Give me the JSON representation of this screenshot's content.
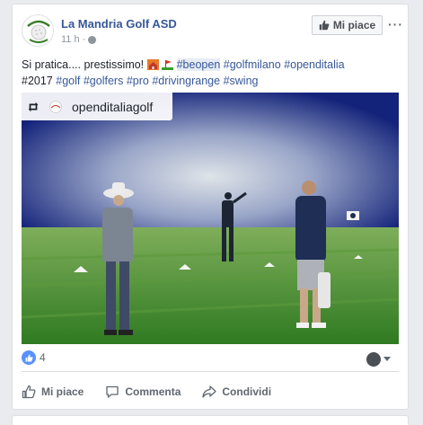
{
  "post": {
    "author": "La Mandria Golf ASD",
    "time": "11 h",
    "separator": "·",
    "text_intro": "Si pratica.... prestissimo!",
    "hashtags_line1": [
      {
        "text": "#beopen",
        "highlight": true
      },
      {
        "text": "#golfmilano",
        "highlight": false
      },
      {
        "text": "#openditalia",
        "highlight": false
      }
    ],
    "hashtags_line2": [
      "#2017",
      "#golf",
      "#golfers",
      "#pro",
      "#drivingrange",
      "#swing"
    ],
    "instagram_user": "openditaliagolf",
    "like_count": "4"
  },
  "header": {
    "like_page_label": "Mi piace",
    "more_label": "···"
  },
  "actions": {
    "like": "Mi piace",
    "comment": "Commenta",
    "share": "Condividi"
  },
  "colors": {
    "link": "#365899",
    "like_blue": "#5890ff",
    "photo_sky": "#0d1f6e",
    "photo_grass": "#3f8a2a"
  },
  "icons": [
    "golf-ball-logo",
    "globe-icon",
    "thumbs-up-icon",
    "more-icon",
    "house-emoji",
    "golf-flag-emoji",
    "repost-icon",
    "comment-icon",
    "share-icon",
    "caret-down-icon"
  ]
}
